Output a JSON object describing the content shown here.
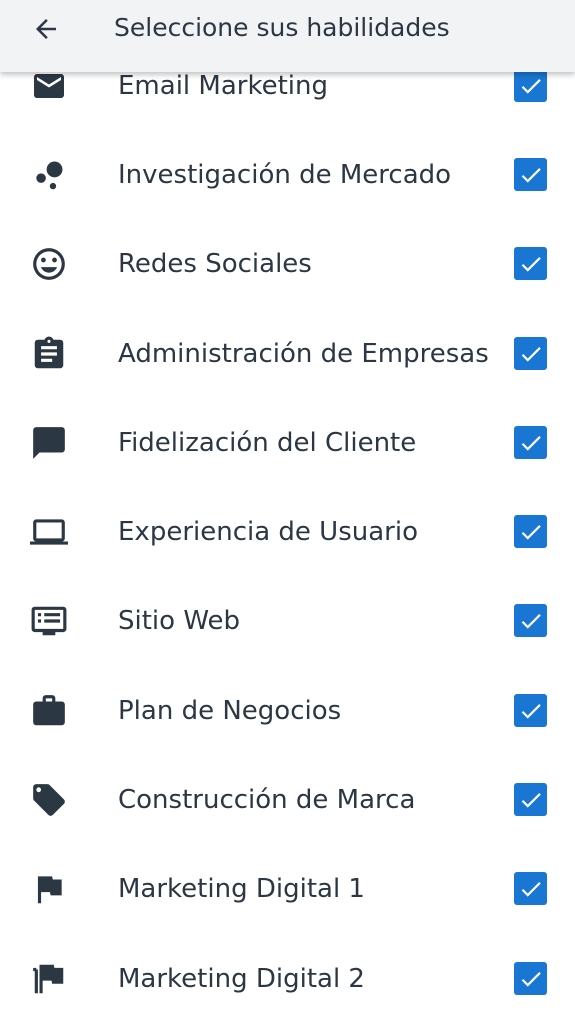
{
  "app_bar": {
    "title": "Seleccione sus habilidades",
    "back_icon": "arrow-left-icon"
  },
  "accent_color": "#1976d2",
  "skills": [
    {
      "label": "Email Marketing",
      "icon": "mail-icon",
      "checked": true
    },
    {
      "label": "Investigación de Mercado",
      "icon": "bubbles-icon",
      "checked": true
    },
    {
      "label": "Redes Sociales",
      "icon": "smiley-icon",
      "checked": true
    },
    {
      "label": "Administración de Empresas",
      "icon": "clipboard-icon",
      "checked": true
    },
    {
      "label": "Fidelización del Cliente",
      "icon": "chat-icon",
      "checked": true
    },
    {
      "label": "Experiencia de Usuario",
      "icon": "laptop-icon",
      "checked": true
    },
    {
      "label": "Sitio Web",
      "icon": "web-icon",
      "checked": true
    },
    {
      "label": "Plan de Negocios",
      "icon": "briefcase-icon",
      "checked": true
    },
    {
      "label": "Construcción de Marca",
      "icon": "tag-icon",
      "checked": true
    },
    {
      "label": "Marketing Digital 1",
      "icon": "flag-icon",
      "checked": true
    },
    {
      "label": "Marketing Digital 2",
      "icon": "flags-icon",
      "checked": true
    }
  ]
}
